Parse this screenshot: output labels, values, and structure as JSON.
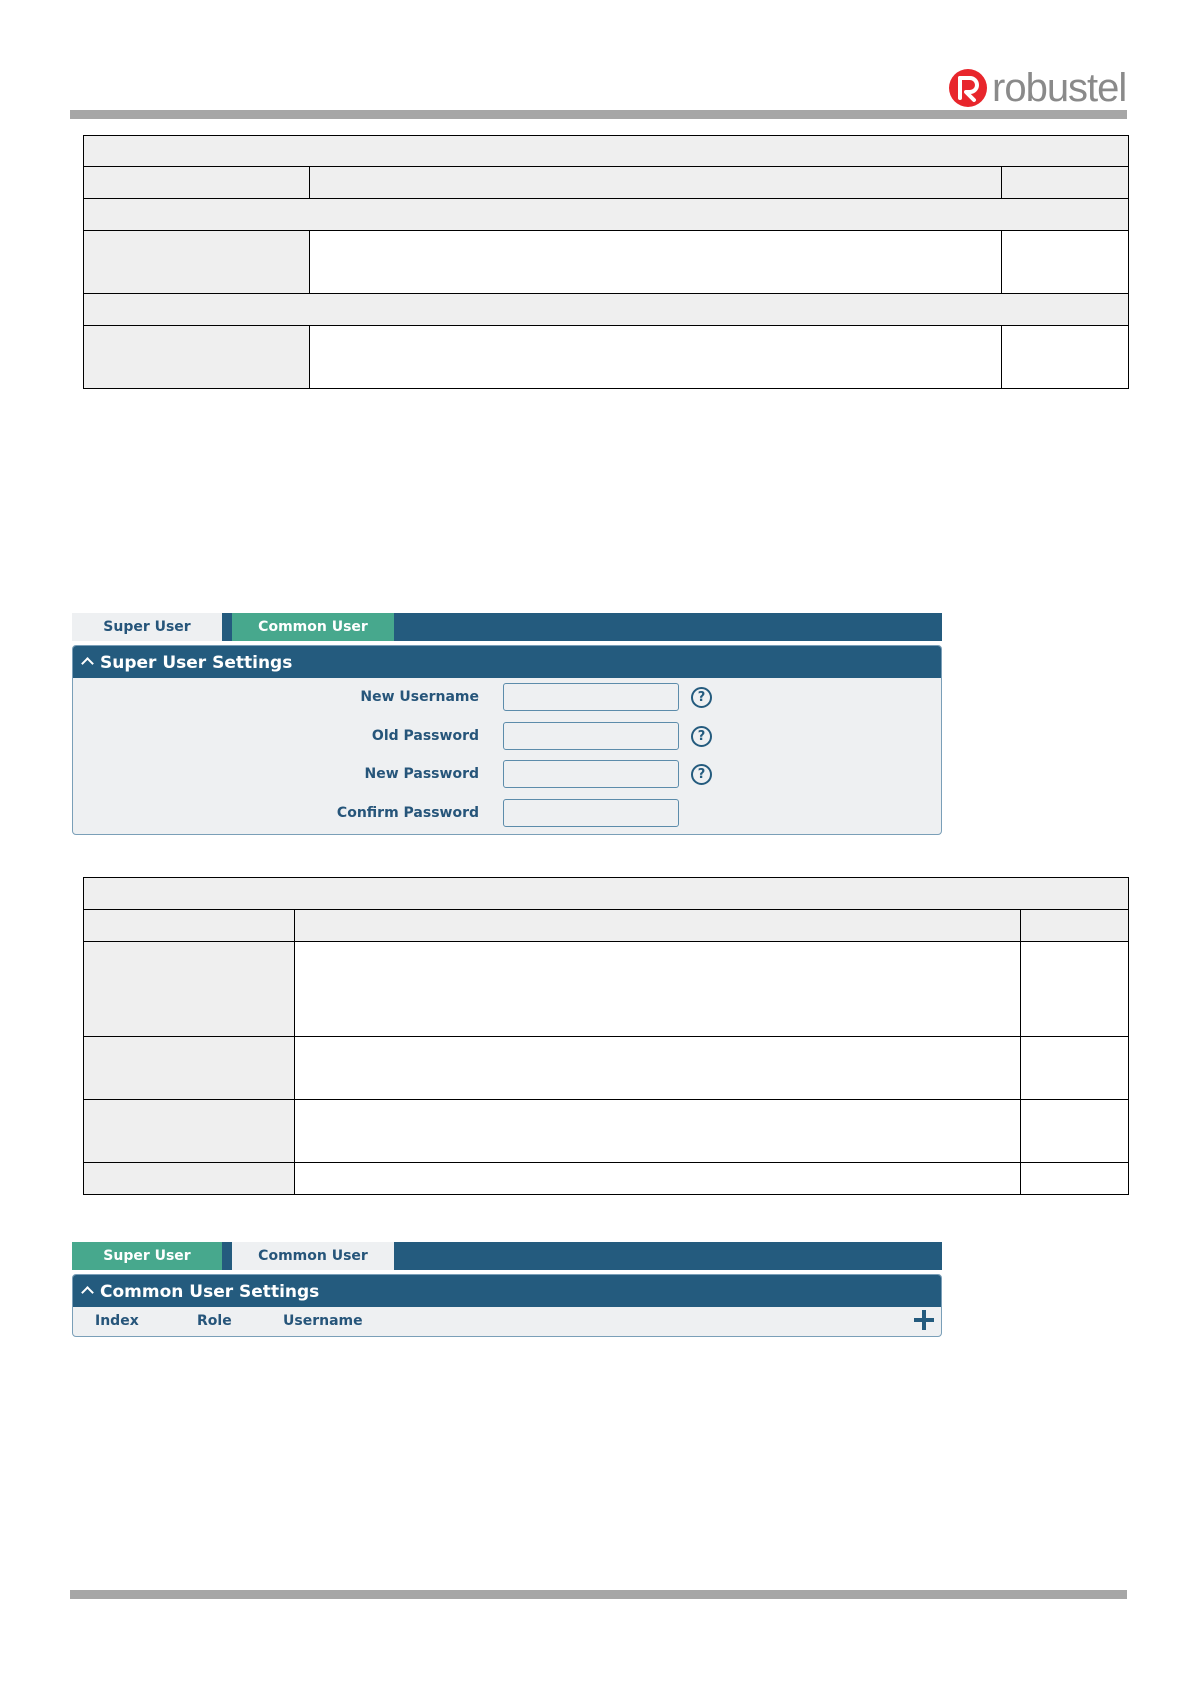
{
  "brand": {
    "name": "robustel",
    "mark_color": "#e8262c",
    "text_color": "#8a8a8a"
  },
  "super_user_screen": {
    "tabs": [
      {
        "label": "Super User",
        "active": true
      },
      {
        "label": "Common User",
        "active": false
      }
    ],
    "section_title": "Super User Settings",
    "fields": [
      {
        "label": "New Username",
        "value": "",
        "has_help": true
      },
      {
        "label": "Old Password",
        "value": "",
        "has_help": true
      },
      {
        "label": "New Password",
        "value": "",
        "has_help": true
      },
      {
        "label": "Confirm Password",
        "value": "",
        "has_help": false
      }
    ]
  },
  "common_user_screen": {
    "tabs": [
      {
        "label": "Super User",
        "active": false
      },
      {
        "label": "Common User",
        "active": true
      }
    ],
    "section_title": "Common User Settings",
    "columns": [
      "Index",
      "Role",
      "Username"
    ],
    "add_icon": "plus-icon"
  },
  "colors": {
    "header_blue": "#245b7e",
    "tab_green": "#47a88d",
    "label_blue": "#26557a",
    "panel_bg": "#eef0f2"
  }
}
